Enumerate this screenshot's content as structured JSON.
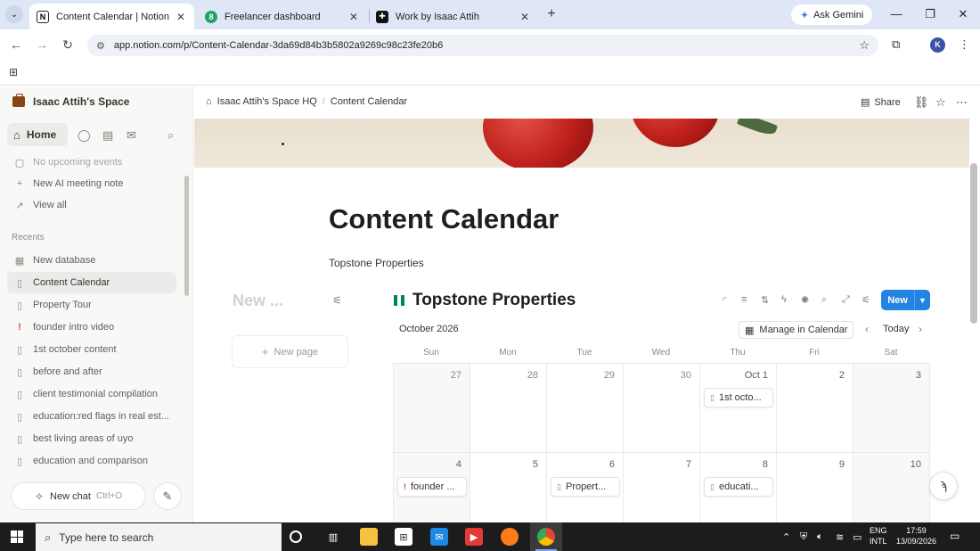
{
  "browser": {
    "tabs": [
      {
        "title": "Content Calendar | Notion",
        "favicon": "N",
        "active": true
      },
      {
        "title": "Freelancer dashboard",
        "favicon": "8",
        "active": false
      },
      {
        "title": "Work by Isaac Attih",
        "favicon": "✚",
        "active": false
      }
    ],
    "ask_gemini": "Ask Gemini",
    "url": "app.notion.com/p/Content-Calendar-3da69d84b3b5802a9269c98c23fe20b6",
    "profile_initial": "K"
  },
  "sidebar": {
    "workspace": "Isaac Attih's Space",
    "home": "Home",
    "top_items": [
      {
        "label": "No upcoming events",
        "icon": "calendar-icon"
      },
      {
        "label": "New AI meeting note",
        "icon": "plus-icon"
      },
      {
        "label": "View all",
        "icon": "arrow-icon"
      }
    ],
    "recents_label": "Recents",
    "recents": [
      {
        "label": "New database",
        "icon": "table-icon"
      },
      {
        "label": "Content Calendar",
        "icon": "page-icon"
      },
      {
        "label": "Property Tour",
        "icon": "page-icon"
      },
      {
        "label": "founder intro video",
        "icon": "exclamation-icon"
      },
      {
        "label": "1st october content",
        "icon": "page-icon"
      },
      {
        "label": "before and after",
        "icon": "page-icon"
      },
      {
        "label": "client testimonial compilation",
        "icon": "page-icon"
      },
      {
        "label": "education:red flags in real est...",
        "icon": "page-icon"
      },
      {
        "label": "best living areas of uyo",
        "icon": "page-icon"
      },
      {
        "label": "education and comparison",
        "icon": "page-icon"
      }
    ],
    "new_chat": "New chat",
    "new_chat_shortcut": "Ctrl+O"
  },
  "topbar": {
    "breadcrumb": [
      "Isaac Attih's Space HQ",
      "Content Calendar"
    ],
    "share": "Share"
  },
  "page": {
    "title": "Content Calendar",
    "property": "Topstone Properties"
  },
  "left_db": {
    "title": "New ...",
    "new_page": "New page"
  },
  "calendar": {
    "title": "Topstone Properties",
    "new_label": "New",
    "month": "October 2026",
    "manage": "Manage in Calendar",
    "today": "Today",
    "weekdays": [
      "Sun",
      "Mon",
      "Tue",
      "Wed",
      "Thu",
      "Fri",
      "Sat"
    ],
    "weeks": [
      [
        {
          "day": "27",
          "muted": true,
          "weekend": true,
          "event": null
        },
        {
          "day": "28",
          "muted": true,
          "weekend": false,
          "event": null
        },
        {
          "day": "29",
          "muted": true,
          "weekend": false,
          "event": null
        },
        {
          "day": "30",
          "muted": true,
          "weekend": false,
          "event": null
        },
        {
          "day": "Oct 1",
          "muted": false,
          "weekend": false,
          "event": "1st octo..."
        },
        {
          "day": "2",
          "muted": false,
          "weekend": false,
          "event": null
        },
        {
          "day": "3",
          "muted": false,
          "weekend": true,
          "event": null
        }
      ],
      [
        {
          "day": "4",
          "muted": false,
          "weekend": true,
          "event": "founder ..."
        },
        {
          "day": "5",
          "muted": false,
          "weekend": false,
          "event": null
        },
        {
          "day": "6",
          "muted": false,
          "weekend": false,
          "event": "Propert..."
        },
        {
          "day": "7",
          "muted": false,
          "weekend": false,
          "event": null
        },
        {
          "day": "8",
          "muted": false,
          "weekend": false,
          "event": "educati..."
        },
        {
          "day": "9",
          "muted": false,
          "weekend": false,
          "event": null
        },
        {
          "day": "10",
          "muted": false,
          "weekend": true,
          "event": null
        }
      ]
    ]
  },
  "taskbar": {
    "search_placeholder": "Type here to search",
    "lang_line1": "ENG",
    "lang_line2": "INTL",
    "time": "17:59",
    "date": "13/09/2026"
  },
  "colors": {
    "accent": "#2383e2",
    "flag_green": "#008751",
    "workspace_icon": "#8b4513"
  }
}
